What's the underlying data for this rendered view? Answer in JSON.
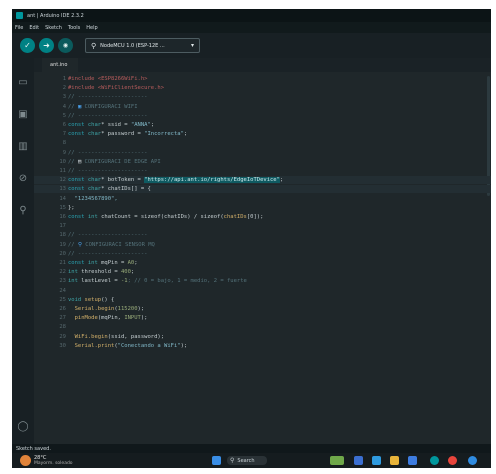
{
  "window": {
    "title": "ant | Arduino IDE 2.3.2"
  },
  "menubar": {
    "items": [
      "File",
      "Edit",
      "Sketch",
      "Tools",
      "Help"
    ]
  },
  "toolbar": {
    "verify_icon": "check-icon",
    "upload_icon": "arrow-right-icon",
    "debug_icon": "debug-icon",
    "board_selector": {
      "icon": "usb-icon",
      "label": "NodeMCU 1.0 (ESP-12E ...",
      "caret": "▾"
    }
  },
  "activity_bar": [
    "sketchbook-icon",
    "boards-manager-icon",
    "library-manager-icon",
    "debug-icon",
    "search-icon",
    "account-icon"
  ],
  "tabs": [
    {
      "label": "ant.ino"
    }
  ],
  "editor": {
    "lines": [
      {
        "n": "1",
        "tokens": [
          [
            "pp",
            "#include <ESP8266WiFi.h>"
          ]
        ]
      },
      {
        "n": "2",
        "tokens": [
          [
            "pp",
            "#include <WiFiClientSecure.h>"
          ]
        ]
      },
      {
        "n": "3",
        "tokens": [
          [
            "cm",
            "// ---------------------"
          ]
        ]
      },
      {
        "n": "4",
        "tokens": [
          [
            "cm",
            "// "
          ],
          [
            "emoji",
            "▣"
          ],
          [
            "cm",
            " CONFIGURACI WIFI"
          ]
        ]
      },
      {
        "n": "5",
        "tokens": [
          [
            "cm",
            "// ---------------------"
          ]
        ]
      },
      {
        "n": "6",
        "tokens": [
          [
            "kw",
            "const "
          ],
          [
            "ty",
            "char"
          ],
          [
            "txt",
            "* ssid = "
          ],
          [
            "str",
            "\"ANNA\""
          ],
          [
            "txt",
            ";"
          ]
        ]
      },
      {
        "n": "7",
        "tokens": [
          [
            "kw",
            "const "
          ],
          [
            "ty",
            "char"
          ],
          [
            "txt",
            "* password = "
          ],
          [
            "str",
            "\"Incorrecta\""
          ],
          [
            "txt",
            ";"
          ]
        ]
      },
      {
        "n": "8",
        "tokens": []
      },
      {
        "n": "9",
        "tokens": [
          [
            "cm",
            "// ---------------------"
          ]
        ]
      },
      {
        "n": "10",
        "tokens": [
          [
            "cm",
            "// "
          ],
          [
            "txt",
            "▤"
          ],
          [
            "cm",
            " CONFIGURACI DE EDGE API"
          ]
        ]
      },
      {
        "n": "11",
        "tokens": [
          [
            "cm",
            "// ---------------------"
          ]
        ]
      },
      {
        "n": "12",
        "tokens": [
          [
            "kw",
            "const "
          ],
          [
            "ty",
            "char"
          ],
          [
            "txt",
            "* botToken = "
          ],
          [
            "url",
            "\"https://api.ant.io/rights/EdgeIoTDevice\""
          ],
          [
            "txt",
            ";"
          ]
        ]
      },
      {
        "n": "13",
        "tokens": [
          [
            "kw",
            "const "
          ],
          [
            "ty",
            "char"
          ],
          [
            "txt",
            "* chatIDs[] = {"
          ]
        ]
      },
      {
        "n": "14",
        "tokens": [
          [
            "str",
            "  \"1234567890\","
          ]
        ]
      },
      {
        "n": "15",
        "tokens": [
          [
            "txt",
            "};"
          ]
        ]
      },
      {
        "n": "16",
        "tokens": [
          [
            "kw",
            "const "
          ],
          [
            "ty",
            "int"
          ],
          [
            "txt",
            " chatCount = sizeof(chatIDs) / sizeof("
          ],
          [
            "fn",
            "chatIDs"
          ],
          [
            "txt",
            "[0]);"
          ]
        ]
      },
      {
        "n": "17",
        "tokens": []
      },
      {
        "n": "18",
        "tokens": [
          [
            "cm",
            "// ---------------------"
          ]
        ]
      },
      {
        "n": "19",
        "tokens": [
          [
            "cm",
            "// "
          ],
          [
            "emoji",
            "⚲"
          ],
          [
            "cm",
            " CONFIGURACI SENSOR MQ"
          ]
        ]
      },
      {
        "n": "20",
        "tokens": [
          [
            "cm",
            "// ---------------------"
          ]
        ]
      },
      {
        "n": "21",
        "tokens": [
          [
            "kw",
            "const "
          ],
          [
            "ty",
            "int"
          ],
          [
            "txt",
            " mqPin = "
          ],
          [
            "num",
            "A0"
          ],
          [
            "txt",
            ";"
          ]
        ]
      },
      {
        "n": "22",
        "tokens": [
          [
            "ty",
            "int"
          ],
          [
            "txt",
            " threshold = "
          ],
          [
            "num",
            "400"
          ],
          [
            "txt",
            ";"
          ]
        ]
      },
      {
        "n": "23",
        "tokens": [
          [
            "ty",
            "int"
          ],
          [
            "txt",
            " lastLevel = "
          ],
          [
            "num",
            "-1"
          ],
          [
            "cm",
            "; // 0 = bajo, 1 = medio, 2 = fuerte"
          ]
        ]
      },
      {
        "n": "24",
        "tokens": []
      },
      {
        "n": "25",
        "tokens": [
          [
            "ty",
            "void"
          ],
          [
            "fn",
            " setup"
          ],
          [
            "txt",
            "() {"
          ]
        ]
      },
      {
        "n": "26",
        "tokens": [
          [
            "fn",
            "  Serial.begin"
          ],
          [
            "txt",
            "("
          ],
          [
            "num",
            "115200"
          ],
          [
            "txt",
            ");"
          ]
        ]
      },
      {
        "n": "27",
        "tokens": [
          [
            "fn",
            "  pinMode"
          ],
          [
            "txt",
            "(mqPin, "
          ],
          [
            "num",
            "INPUT"
          ],
          [
            "txt",
            ");"
          ]
        ]
      },
      {
        "n": "28",
        "tokens": []
      },
      {
        "n": "29",
        "tokens": [
          [
            "fn",
            "  WiFi.begin"
          ],
          [
            "txt",
            "(ssid, password);"
          ]
        ]
      },
      {
        "n": "30",
        "tokens": [
          [
            "fn",
            "  Serial.print"
          ],
          [
            "txt",
            "("
          ],
          [
            "str",
            "\"Conectando a WiFi\""
          ],
          [
            "txt",
            ");"
          ]
        ]
      }
    ],
    "highlighted_lines": [
      "12",
      "13"
    ]
  },
  "status": {
    "text": "Sketch saved."
  },
  "taskbar": {
    "weather_icon": "sun-icon",
    "weather_temp": "28°C",
    "weather_desc": "Mayorm. soleado",
    "search_placeholder": "Search",
    "search_icon": "search-icon"
  }
}
